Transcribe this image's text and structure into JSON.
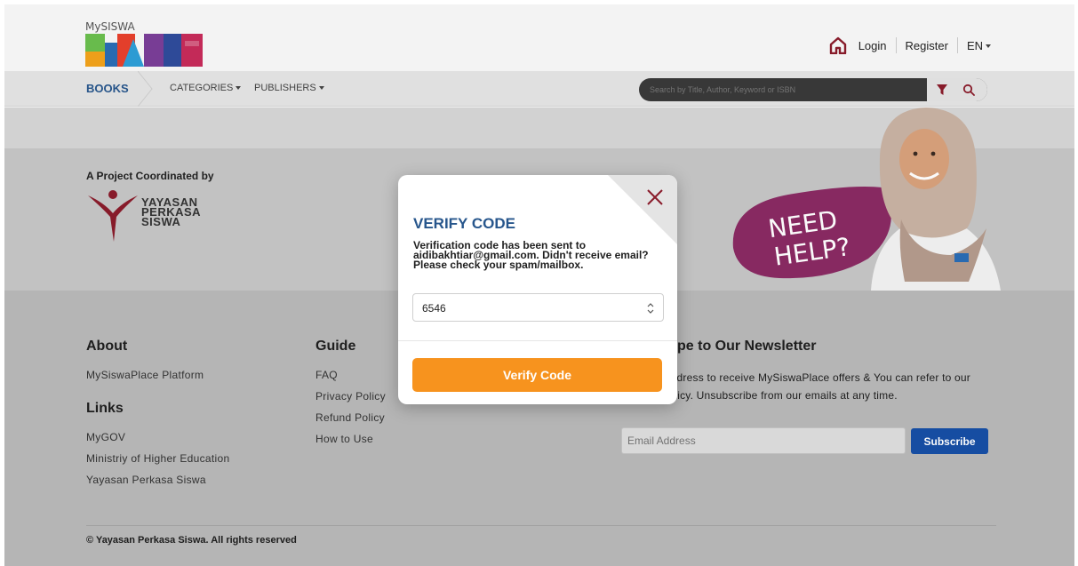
{
  "header": {
    "logo_small": "MySISWA",
    "logo_small_prefix": "My",
    "logo_main": "SISWA",
    "nav": {
      "login": "Login",
      "register": "Register",
      "language": "EN"
    }
  },
  "menubar": {
    "books": "BOOKS",
    "categories": "CATEGORIES",
    "publishers": "PUBLISHERS",
    "search_placeholder": "Search by Title, Author, Keyword or ISBN"
  },
  "banner": {
    "coordinated_by": "A Project Coordinated by",
    "org_line1": "YAYASAN",
    "org_line2": "PERKASA",
    "org_line3": "SISWA",
    "help_line1": "NEED",
    "help_line2": "HELP?"
  },
  "footer": {
    "about_title": "About",
    "about_items": [
      "MySiswaPlace Platform"
    ],
    "links_title": "Links",
    "links_items": [
      "MyGOV",
      "Ministriy of Higher Education",
      "Yayasan Perkasa Siswa"
    ],
    "guide_title": "Guide",
    "guide_items": [
      "FAQ",
      "Privacy Policy",
      "Refund Policy",
      "How to Use"
    ],
    "newsletter_title": "pe to Our Newsletter",
    "newsletter_text": "ur email address to receive MySiswaPlace offers & You can refer to our Privacy Policy. Unsubscribe from our emails at any time.",
    "email_placeholder": "Email Address",
    "subscribe": "Subscribe",
    "subscribe_display": "Subscribe",
    "copyright": "© Yayasan Perkasa Siswa. All rights reserved"
  },
  "modal": {
    "title": "VERIFY CODE",
    "description": "Verification code has been sent to aidibakhtiar@gmail.com. Didn't receive email? Please check your spam/mailbox.",
    "code_value": "6546",
    "verify_button": "Verify Code"
  },
  "colors": {
    "brand_blue": "#27568c",
    "accent_orange": "#f7931e",
    "subscribe_blue": "#174fa6",
    "help_purple": "#8a2a63"
  }
}
